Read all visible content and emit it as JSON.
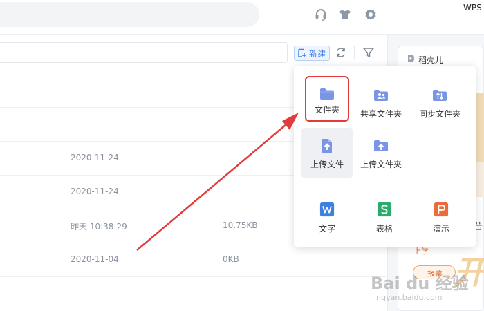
{
  "app": {
    "title": "WPS_"
  },
  "topbar": {
    "icons": [
      "headset-icon",
      "tshirt-icon",
      "gear-icon"
    ]
  },
  "toolbar": {
    "new_label": "新建",
    "refresh_icon": "refresh-icon",
    "filter_icon": "filter-icon"
  },
  "files": {
    "rows": [
      {
        "date": "2020-11-24",
        "size": ""
      },
      {
        "date": "2020-11-24",
        "size": ""
      },
      {
        "date": "昨天 10:38:29",
        "size": "10.75KB"
      },
      {
        "date": "2020-11-04",
        "size": "0KB"
      }
    ]
  },
  "right_panel": {
    "title": "稻壳儿",
    "side_chars": [
      "苦"
    ],
    "promo_text": "上学",
    "promo_pill": "报票",
    "deco_text": "开"
  },
  "dropdown": {
    "items": [
      {
        "label": "文件夹",
        "icon": "folder-icon",
        "color": "#7b95e6"
      },
      {
        "label": "共享文件夹",
        "icon": "shared-folder-icon",
        "color": "#7b95e6"
      },
      {
        "label": "同步文件夹",
        "icon": "sync-folder-icon",
        "color": "#7b95e6"
      },
      {
        "label": "上传文件",
        "icon": "upload-file-icon",
        "color": "#7b95e6"
      },
      {
        "label": "上传文件夹",
        "icon": "upload-folder-icon",
        "color": "#7b95e6"
      },
      {
        "label": "文字",
        "icon": "wps-writer-icon",
        "color": "#3d80e0"
      },
      {
        "label": "表格",
        "icon": "wps-spreadsheet-icon",
        "color": "#2cab6c"
      },
      {
        "label": "演示",
        "icon": "wps-presentation-icon",
        "color": "#ec6b3b"
      }
    ]
  },
  "watermark": {
    "text": "Bai du 经验",
    "sub": "jingyan.baidu.com"
  },
  "colors": {
    "accent": "#3b7ded",
    "annotation": "#e23b3b"
  }
}
